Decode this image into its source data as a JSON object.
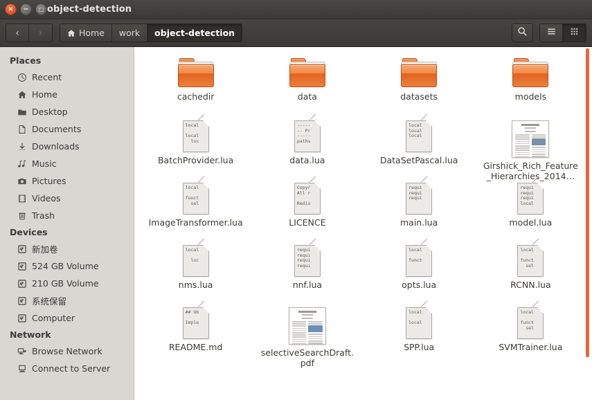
{
  "window": {
    "title": "object-detection",
    "close_label": "×",
    "min_label": "−",
    "max_label": "□"
  },
  "toolbar": {
    "back_label": "‹",
    "forward_label": "›",
    "search_icon": "search-icon",
    "list_view_icon": "list-view-icon",
    "grid_view_icon": "grid-view-icon",
    "breadcrumbs": [
      {
        "label": "Home",
        "icon": "home-icon",
        "active": false
      },
      {
        "label": "work",
        "icon": "",
        "active": false
      },
      {
        "label": "object-detection",
        "icon": "",
        "active": true
      }
    ]
  },
  "sidebar": {
    "sections": [
      {
        "heading": "Places",
        "items": [
          {
            "label": "Recent",
            "icon": "clock-icon",
            "glyph": "◴"
          },
          {
            "label": "Home",
            "icon": "home-icon",
            "glyph": "⌂"
          },
          {
            "label": "Desktop",
            "icon": "desktop-icon",
            "glyph": "◰"
          },
          {
            "label": "Documents",
            "icon": "document-icon",
            "glyph": "☰"
          },
          {
            "label": "Downloads",
            "icon": "download-icon",
            "glyph": "↓"
          },
          {
            "label": "Music",
            "icon": "music-icon",
            "glyph": "♫"
          },
          {
            "label": "Pictures",
            "icon": "camera-icon",
            "glyph": "◎"
          },
          {
            "label": "Videos",
            "icon": "film-icon",
            "glyph": "▤"
          },
          {
            "label": "Trash",
            "icon": "trash-icon",
            "glyph": "Ὕ1"
          }
        ]
      },
      {
        "heading": "Devices",
        "items": [
          {
            "label": "新加卷",
            "icon": "drive-icon",
            "glyph": "▣"
          },
          {
            "label": "524 GB Volume",
            "icon": "drive-icon",
            "glyph": "▣"
          },
          {
            "label": "210 GB Volume",
            "icon": "drive-icon",
            "glyph": "▣"
          },
          {
            "label": "系统保留",
            "icon": "drive-icon",
            "glyph": "▣"
          },
          {
            "label": "Computer",
            "icon": "drive-icon",
            "glyph": "▣"
          }
        ]
      },
      {
        "heading": "Network",
        "items": [
          {
            "label": "Browse Network",
            "icon": "network-icon",
            "glyph": "⚇"
          },
          {
            "label": "Connect to Server",
            "icon": "server-icon",
            "glyph": "⎕"
          }
        ]
      }
    ]
  },
  "files": [
    {
      "name": "cachedir",
      "type": "folder",
      "preview": ""
    },
    {
      "name": "data",
      "type": "folder",
      "preview": ""
    },
    {
      "name": "datasets",
      "type": "folder",
      "preview": ""
    },
    {
      "name": "models",
      "type": "folder",
      "preview": ""
    },
    {
      "name": "BatchProvider.lua",
      "type": "text",
      "preview": "local\n\nlocal\n  loc"
    },
    {
      "name": "data.lua",
      "type": "text",
      "preview": "-----\n-- Pr\n-----\npaths"
    },
    {
      "name": "DataSetPascal.lua",
      "type": "text",
      "preview": "local\nlocal\nlocal"
    },
    {
      "name": "Girshick_Rich_Feature_Hierarchies_2014…",
      "type": "pdf",
      "preview": ""
    },
    {
      "name": "ImageTransformer.lua",
      "type": "text",
      "preview": "local\n\nfunct\n  sel"
    },
    {
      "name": "LICENCE",
      "type": "text",
      "preview": "Copyr\nAll r\n\nRedis"
    },
    {
      "name": "main.lua",
      "type": "text",
      "preview": "requi\nrequi\nrequi"
    },
    {
      "name": "model.lua",
      "type": "text",
      "preview": "requi\nrequi\nrequi\nlocal"
    },
    {
      "name": "nms.lua",
      "type": "text",
      "preview": "local\n\n  loc"
    },
    {
      "name": "nnf.lua",
      "type": "text",
      "preview": "requi\nrequi\nrequi\nrequi"
    },
    {
      "name": "opts.lua",
      "type": "text",
      "preview": "local\n\nfunct"
    },
    {
      "name": "RCNN.lua",
      "type": "text",
      "preview": "local\n\nfunct\n  sel"
    },
    {
      "name": "README.md",
      "type": "text",
      "preview": "## Ob\n\nImple"
    },
    {
      "name": "selectiveSearchDraft.pdf",
      "type": "pdf",
      "preview": ""
    },
    {
      "name": "SPP.lua",
      "type": "text",
      "preview": "local\n\nlocal"
    },
    {
      "name": "SVMTrainer.lua",
      "type": "text",
      "preview": "local\n\nfunct\n  sel"
    }
  ],
  "colors": {
    "accent_orange": "#e8663b",
    "folder_orange": "#e4621f",
    "titlebar": "#3c3b37",
    "sidebar_bg": "#dad6d2",
    "text": "#3b3a36"
  }
}
